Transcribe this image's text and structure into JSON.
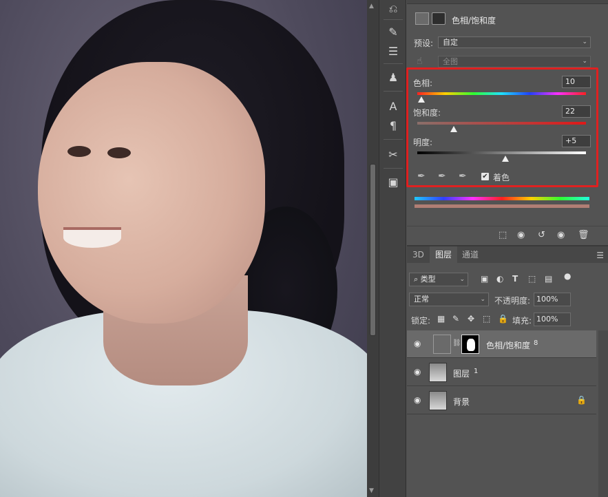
{
  "properties": {
    "title": "色相/饱和度",
    "preset_label": "预设:",
    "preset_value": "自定",
    "channel_value": "全图",
    "hue_label": "色相:",
    "hue_value": "10",
    "saturation_label": "饱和度:",
    "saturation_value": "22",
    "lightness_label": "明度:",
    "lightness_value": "+5",
    "colorize_label": "着色",
    "colorize_checked": true,
    "colorize_check_glyph": "✔"
  },
  "layers": {
    "tabs": [
      "3D",
      "图层",
      "通道"
    ],
    "active_tab": "图层",
    "filter_kind": "类型",
    "blend_mode": "正常",
    "opacity_label": "不透明度:",
    "opacity_value": "100%",
    "lock_label": "锁定:",
    "fill_label": "填充:",
    "fill_value": "100%",
    "items": [
      {
        "name": "色相/饱和度",
        "suffix": "8"
      },
      {
        "name": "图层",
        "suffix": "1"
      },
      {
        "name": "背景",
        "suffix": ""
      }
    ]
  }
}
